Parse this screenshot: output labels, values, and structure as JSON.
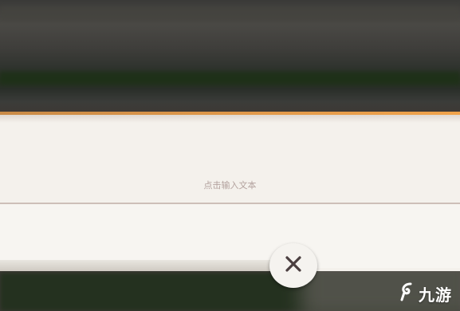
{
  "dialog": {
    "input_placeholder": "点击输入文本",
    "accent_color": "#e39a4a"
  },
  "close_button": {
    "icon": "close-icon"
  },
  "watermark": {
    "text": "九游",
    "icon": "jiuyou-logo-icon"
  }
}
